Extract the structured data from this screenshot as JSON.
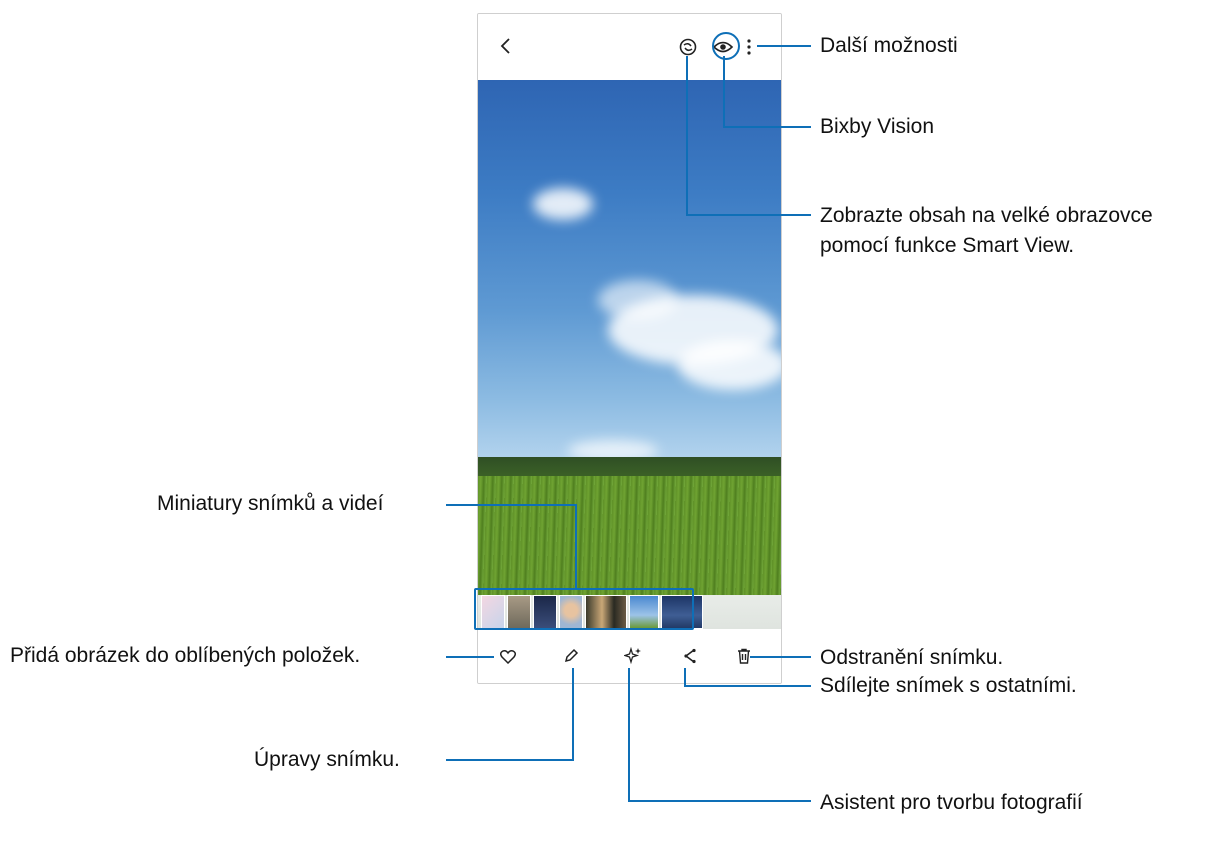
{
  "annotations": {
    "more_options": "Další možnosti",
    "bixby_vision": "Bixby Vision",
    "smart_view_line1": "Zobrazte obsah na velké obrazovce",
    "smart_view_line2": "pomocí funkce Smart View.",
    "thumbnails": "Miniatury snímků a videí",
    "favourite": "Přidá obrázek do oblíbených položek.",
    "delete": "Odstranění snímku.",
    "edit": "Úpravy snímku.",
    "share": "Sdílejte snímek s ostatními.",
    "assistant": "Asistent pro tvorbu fotografií"
  },
  "top_bar": {
    "icons": [
      "back-icon",
      "smart-view-icon",
      "bixby-vision-icon",
      "more-options-icon"
    ]
  },
  "bottom_bar": {
    "icons": [
      "heart-icon",
      "pencil-icon",
      "sparkle-icon",
      "share-icon",
      "trash-icon"
    ]
  },
  "colors": {
    "callout": "#0e6fb7"
  }
}
